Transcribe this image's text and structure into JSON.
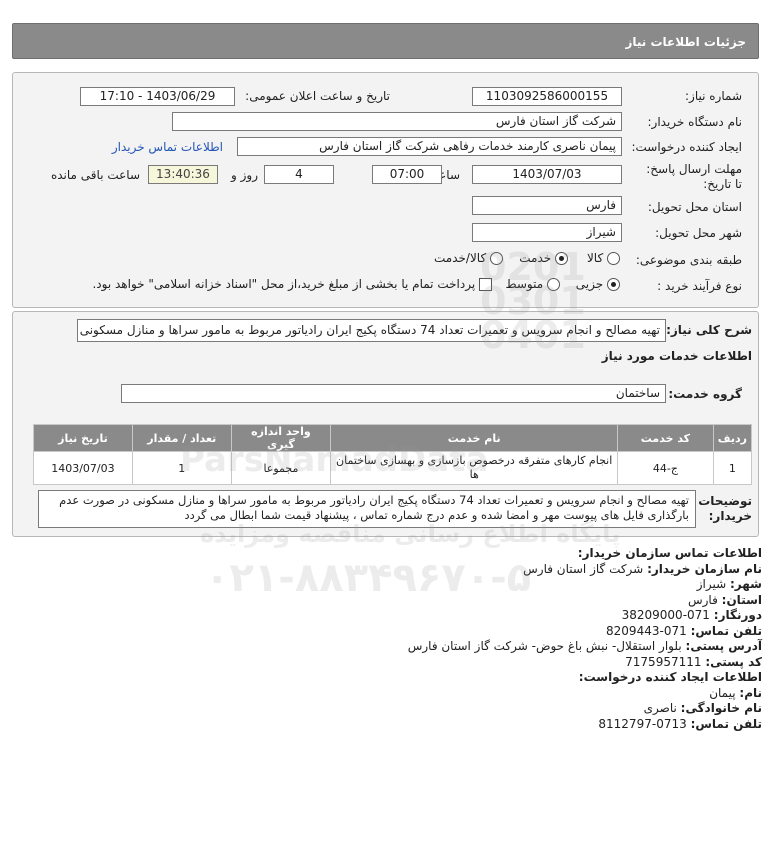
{
  "header": {
    "title": "جزئیات اطلاعات نیاز"
  },
  "form": {
    "need_number_label": "شماره نیاز:",
    "need_number_value": "1103092586000155",
    "announce_label": "تاریخ و ساعت اعلان عمومی:",
    "announce_value": "1403/06/29 - 17:10",
    "buyer_org_label": "نام دستگاه خریدار:",
    "buyer_org_value": "شرکت گاز استان فارس",
    "creator_label": "ایجاد کننده درخواست:",
    "creator_value": "پیمان ناصری کارمند خدمات رفاهی شرکت گاز استان فارس",
    "buyer_contact_link": "اطلاعات تماس خریدار",
    "deadline_label": "مهلت ارسال پاسخ: تا تاریخ:",
    "deadline_date": "1403/07/03",
    "time_label": "ساعت",
    "deadline_time": "07:00",
    "days_value": "4",
    "days_label": "روز و",
    "remaining_time": "13:40:36",
    "remaining_label": "ساعت باقی مانده",
    "province_label": "استان محل تحویل:",
    "province_value": "فارس",
    "city_label": "شهر محل تحویل:",
    "city_value": "شیراز",
    "category_label": "طبقه بندی موضوعی:",
    "category_options": [
      "کالا",
      "خدمت",
      "کالا/خدمت"
    ],
    "category_selected": "خدمت",
    "process_label": "نوع فرآیند خرید :",
    "process_options": [
      "جزیی",
      "متوسط"
    ],
    "process_selected": "جزیی",
    "payment_note": "پرداخت تمام یا بخشی از مبلغ خرید،از محل \"اسناد خزانه اسلامی\" خواهد بود."
  },
  "summary": {
    "label": "شرح کلی نیاز:",
    "value": "تهیه مصالح و انجام سرویس و تعمیرات تعداد 74 دستگاه پکیج ایران رادیاتور مربوط به مامور سراها و منازل مسکونی",
    "services_heading": "اطلاعات خدمات مورد نیاز",
    "service_group_label": "گروه خدمت:",
    "service_group_value": "ساختمان"
  },
  "table": {
    "headers": [
      "ردیف",
      "کد خدمت",
      "نام خدمت",
      "واحد اندازه گیری",
      "تعداد / مقدار",
      "تاریخ نیاز"
    ],
    "rows": [
      [
        "1",
        "ج-44",
        "انجام کارهای متفرقه درخصوص بازسازی و بهسازی ساختمان ها",
        "مجموعا",
        "1",
        "1403/07/03"
      ]
    ]
  },
  "buyer_notes": {
    "label": "توضیحات خریدار:",
    "value": "تهیه مصالح و انجام سرویس و تعمیرات تعداد 74 دستگاه پکیج ایران رادیاتور مربوط به مامور سراها و منازل مسکونی در صورت عدم بارگذاری فایل های پیوست مهر و امضا شده و عدم درج شماره تماس ، پیشنهاد قیمت شما ابطال می گردد"
  },
  "contact": {
    "heading": "اطلاعات تماس سازمان خریدار:",
    "org_label": "نام سازمان خریدار:",
    "org_value": "شرکت گاز استان فارس",
    "city_label": "شهر:",
    "city_value": "شیراز",
    "province_label": "استان:",
    "province_value": "فارس",
    "fax_label": "دورنگار:",
    "fax_value": "071-38209000",
    "phone_label": "تلفن تماس:",
    "phone_value": "071-8209443",
    "address_label": "آدرس پستی:",
    "address_value": "بلوار استقلال- نبش باغ حوض- شرکت گاز استان فارس",
    "postal_label": "کد پستی:",
    "postal_value": "7175957111",
    "creator_heading": "اطلاعات ایجاد کننده درخواست:",
    "name_label": "نام:",
    "name_value": "پیمان",
    "family_label": "نام خانوادگی:",
    "family_value": "ناصری",
    "creator_phone_label": "تلفن تماس:",
    "creator_phone_value": "0713-8112797"
  },
  "watermark": {
    "brand": "ParsNamadData",
    "line": "پایگاه اطلاع رسانی مناقصه ومزایده",
    "phone": "۰۲۱-۸۸۳۴۹۶۷۰-۵",
    "code": "0201 0301 0401"
  }
}
